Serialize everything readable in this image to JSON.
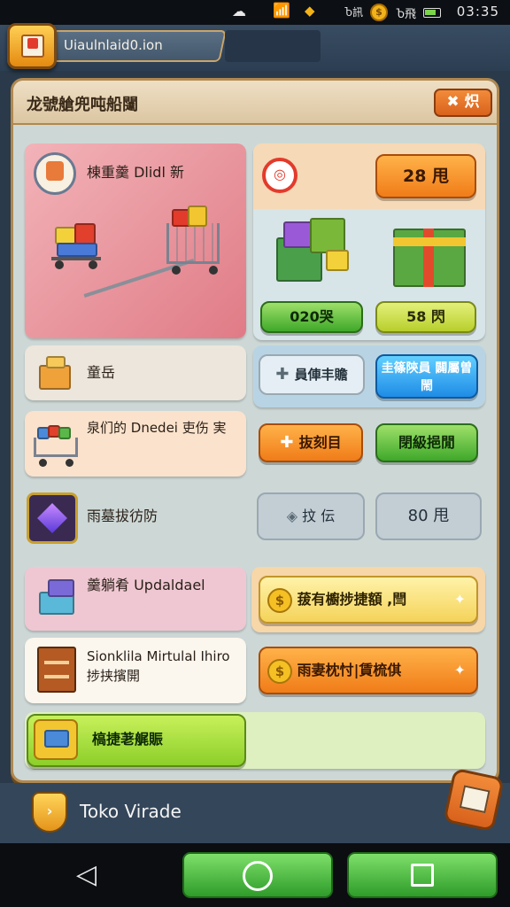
{
  "status_bar": {
    "time": "03:35",
    "sim_text": "Ⴆ訊",
    "signal_text": "Ⴆ飛",
    "coin_symbol": "$"
  },
  "header": {
    "app_title": "Uiaulnlaid0.ion"
  },
  "panel": {
    "title": "龙號艙兜吨船闥",
    "close_label": "✖ 炽"
  },
  "shop": {
    "featured_label": "棟重羹 Dlidl 新",
    "featured_price": "28 甩",
    "featured_icon": "ring-icon",
    "deal_left_price": "020哭",
    "deal_right_price": "58 閃",
    "storage_label": "童岳",
    "storage_action_1": "員俥丰贍",
    "storage_action_2": "圭篠陝員 闢屬曽閙",
    "cart_label": "泉们的 Dnedei 吏伤 実",
    "cart_action_1": "抜刻目",
    "cart_action_2": "閉級挹閒",
    "gem_label": "雨墓拔彷防",
    "gem_action_1": "抆 伝",
    "gem_action_2": "80 甩",
    "upgrade_label": "羹躺肴 Updaldael",
    "upgrade_action": "菝有櫥捗捷額 ,閆",
    "virtual_label_line1": "Sionklila Mirtulal Ihiro",
    "virtual_label_line2": "捗挟擯開",
    "virtual_action": "雨妻枕忖|賃梳倛",
    "special_label": "槁捷荖艉賑"
  },
  "footer": {
    "shop_name": "Toko Virade"
  },
  "colors": {
    "accent_orange": "#f07c18",
    "accent_green": "#3fa82a",
    "accent_blue": "#1f8ce6",
    "frame_gold": "#b0884f"
  }
}
